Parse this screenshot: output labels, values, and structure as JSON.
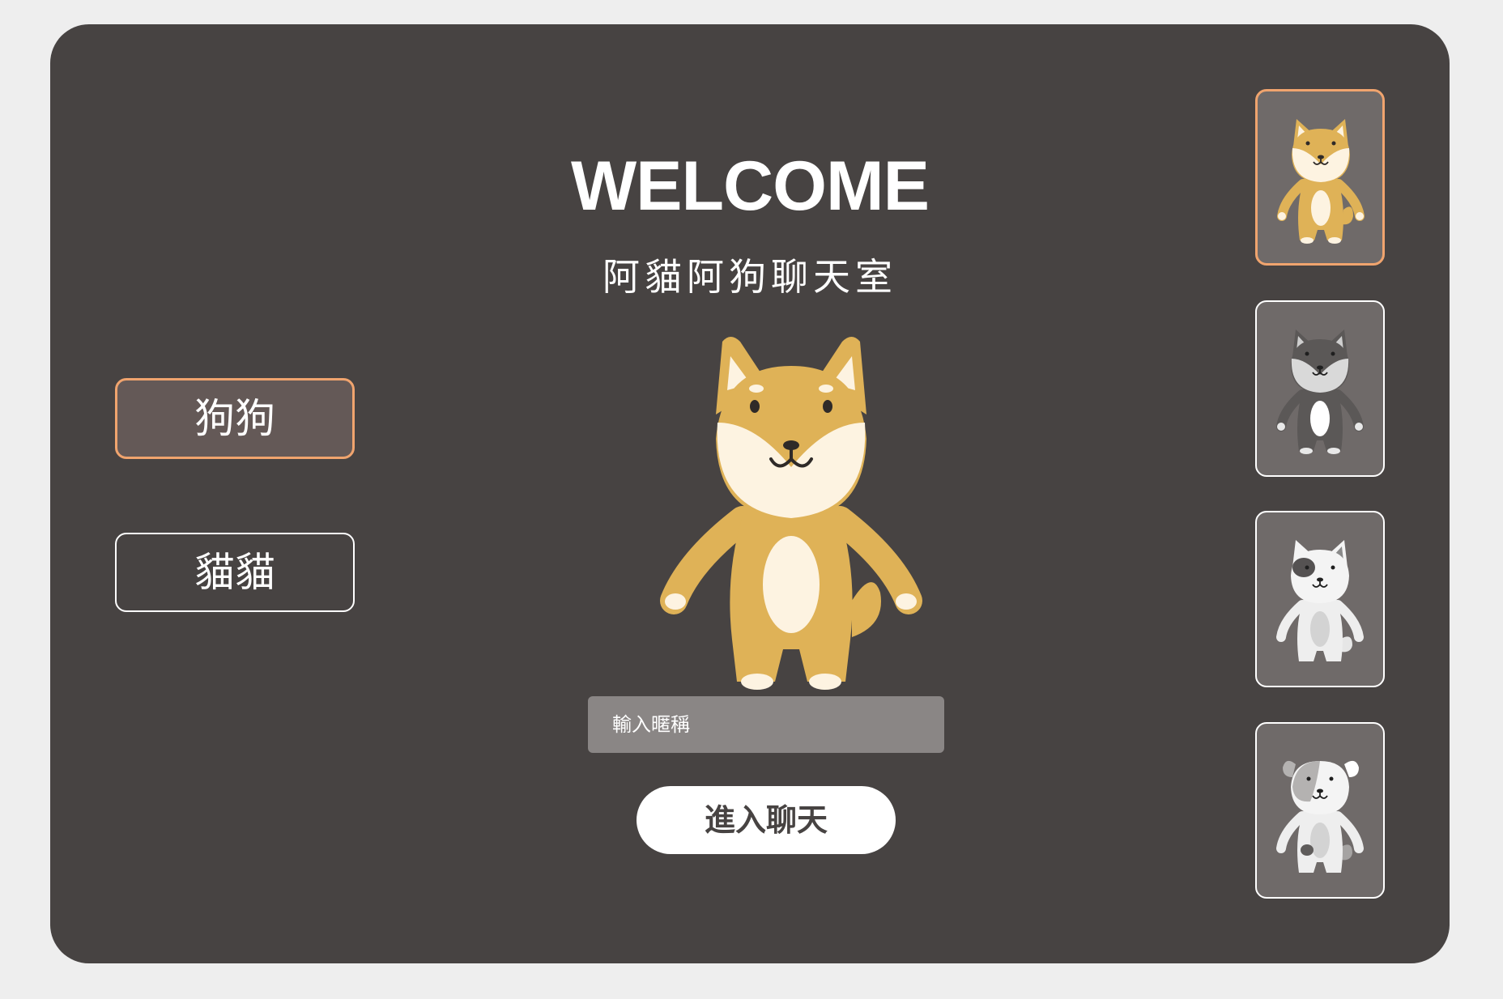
{
  "header": {
    "title": "WELCOME",
    "subtitle": "阿貓阿狗聊天室"
  },
  "categories": [
    {
      "label": "狗狗",
      "selected": true
    },
    {
      "label": "貓貓",
      "selected": false
    }
  ],
  "nickname": {
    "placeholder": "輸入暱稱",
    "value": ""
  },
  "enter_button": {
    "label": "進入聊天"
  },
  "avatars": [
    {
      "icon": "shiba-dog-icon",
      "selected": true
    },
    {
      "icon": "grey-husky-dog-icon",
      "selected": false
    },
    {
      "icon": "white-spotted-dog-icon",
      "selected": false
    },
    {
      "icon": "floppy-ear-dog-icon",
      "selected": false
    }
  ],
  "colors": {
    "background": "#eeeeee",
    "card": "#474342",
    "accent": "#f0a46e",
    "selected_button": "#645957",
    "input": "#8a8685",
    "avatar_card": "#6f6a69",
    "shiba_fur": "#dfb257",
    "shiba_cream": "#fdf3e1"
  }
}
